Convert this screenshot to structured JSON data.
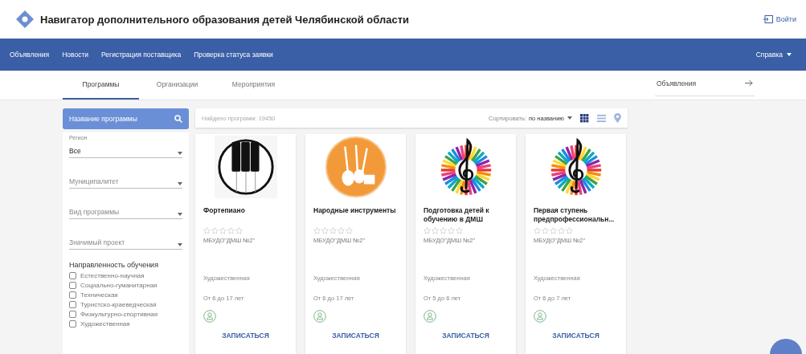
{
  "header": {
    "title": "Навигатор дополнительного образования детей Челябинской области",
    "login": "Войти"
  },
  "nav": {
    "items": [
      "Объявления",
      "Новости",
      "Регистрация поставщика",
      "Проверка статуса заявки"
    ],
    "help": "Справка"
  },
  "tabs": [
    {
      "label": "Программы",
      "selected": true
    },
    {
      "label": "Организации",
      "selected": false
    },
    {
      "label": "Мероприятия",
      "selected": false
    }
  ],
  "announcements": {
    "label": "Объявления"
  },
  "sidebar": {
    "search_button": "Название программы",
    "selects": [
      {
        "label": "Регион",
        "value": "Все"
      },
      {
        "placeholder": "Муниципалитет"
      },
      {
        "placeholder": "Вид программы"
      },
      {
        "placeholder": "Значимый проект"
      }
    ],
    "focus_title": "Направленность обучения",
    "focus_options": [
      {
        "label": "Естественно-научная",
        "checked": false
      },
      {
        "label": "Социально-гуманитарная",
        "checked": false
      },
      {
        "label": "Техническая",
        "checked": false
      },
      {
        "label": "Туристско-краеведческая",
        "checked": false
      },
      {
        "label": "Физкультурно-спортивная",
        "checked": false
      },
      {
        "label": "Художественная",
        "checked": false
      }
    ]
  },
  "toolbar": {
    "found": "Найдено программ: 19450",
    "sort_label": "Сортировать:",
    "sort_value": "по названию",
    "views": [
      {
        "kind": "grid",
        "selected": true
      },
      {
        "kind": "list",
        "selected": false
      },
      {
        "kind": "map",
        "selected": false
      }
    ]
  },
  "cards": [
    {
      "kind": "piano",
      "title": "Фортепиано",
      "stars": 0,
      "organization": "МБУДО\"ДМШ №2\"",
      "category": "Художественная",
      "age": "От 6 до 17 лет",
      "button": "ЗАПИСАТЬСЯ"
    },
    {
      "kind": "folk",
      "title": "Народные инструменты",
      "stars": 0,
      "organization": "МБУДО\"ДМШ №2\"",
      "category": "Художественная",
      "age": "От 6 до 17 лет",
      "button": "ЗАПИСАТЬСЯ"
    },
    {
      "kind": "clef",
      "title": "Подготовка детей к обучению в ДМШ",
      "stars": 0,
      "organization": "МБУДО\"ДМШ №2\"",
      "category": "Художественная",
      "age": "От 5 до 6 лет",
      "button": "ЗАПИСАТЬСЯ"
    },
    {
      "kind": "clef",
      "title": "Первая ступень предпрофессиональн...",
      "stars": 0,
      "organization": "МБУДО\"ДМШ №2\"",
      "category": "Художественная",
      "age": "От 6 до 7 лет",
      "button": "ЗАПИСАТЬСЯ"
    }
  ]
}
